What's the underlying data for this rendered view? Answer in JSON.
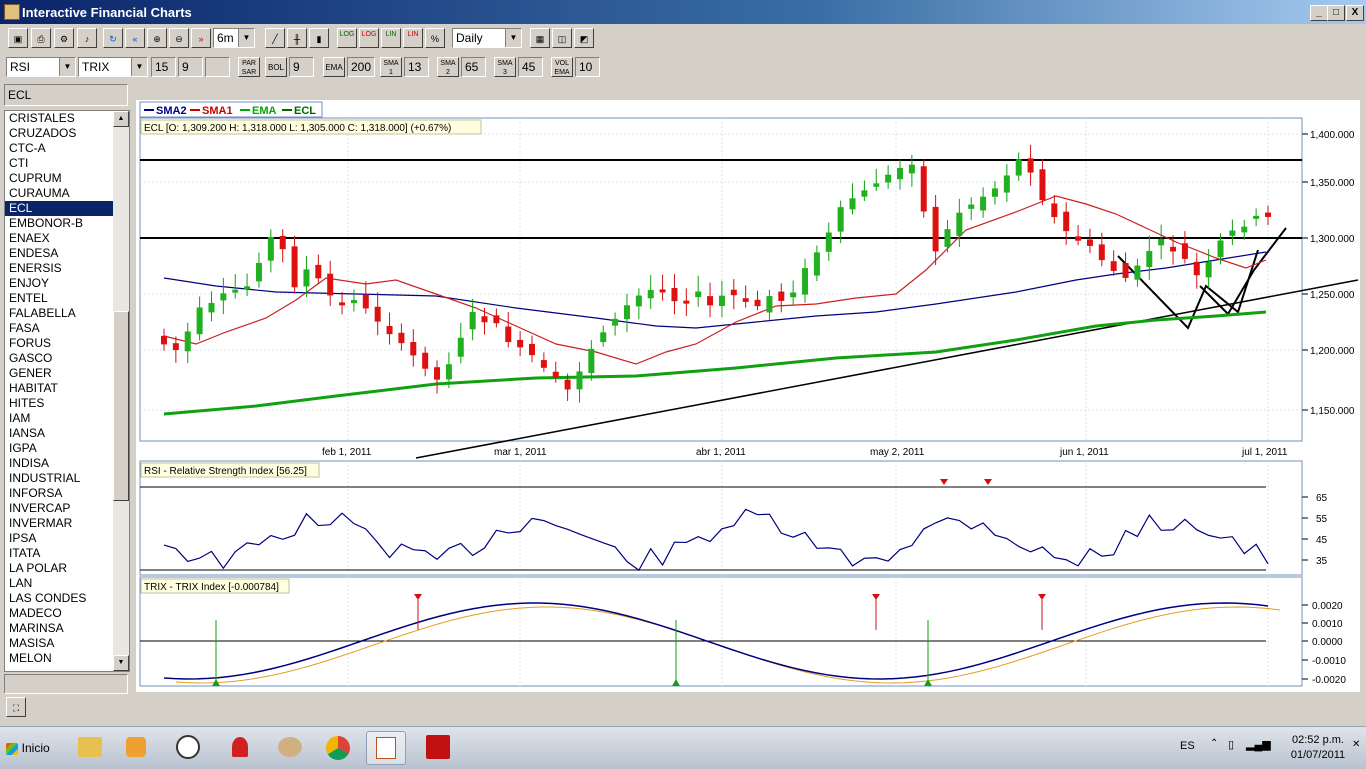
{
  "window": {
    "title": "Interactive Financial Charts",
    "min": "_",
    "max": "□",
    "close": "X"
  },
  "toolbar": {
    "period": "6m",
    "interval": "Daily",
    "log_btn": "LOG",
    "log2_btn": "LOG",
    "lin_btn": "LIN",
    "lin2_btn": "LIN",
    "pct_btn": "%"
  },
  "indicators": {
    "ind1": "RSI",
    "ind2": "TRIX",
    "ind2_p1": "15",
    "ind2_p2": "9",
    "ind2_p3": "",
    "par_sar": "PAR SAR",
    "bol": "BOL",
    "bol_val": "9",
    "ema": "EMA",
    "ema_val": "200",
    "sma1": "SMA 1",
    "sma1_val": "13",
    "sma2": "SMA 2",
    "sma2_val": "65",
    "sma3": "SMA 3",
    "sma3_val": "45",
    "vol_ema": "VOL EMA",
    "vol_ema_val": "10"
  },
  "sidebar": {
    "symbol": "ECL",
    "items": [
      "CRISTALES",
      "CRUZADOS",
      "CTC-A",
      "CTI",
      "CUPRUM",
      "CURAUMA",
      "ECL",
      "EMBONOR-B",
      "ENAEX",
      "ENDESA",
      "ENERSIS",
      "ENJOY",
      "ENTEL",
      "FALABELLA",
      "FASA",
      "FORUS",
      "GASCO",
      "GENER",
      "HABITAT",
      "HITES",
      "IAM",
      "IANSA",
      "IGPA",
      "INDISA",
      "INDUSTRIAL",
      "INFORSA",
      "INVERCAP",
      "INVERMAR",
      "IPSA",
      "ITATA",
      "LA POLAR",
      "LAN",
      "LAS CONDES",
      "MADECO",
      "MARINSA",
      "MASISA",
      "MELON"
    ],
    "selected_index": 6
  },
  "chart": {
    "legend": [
      {
        "name": "SMA2",
        "color": "#000080"
      },
      {
        "name": "SMA1",
        "color": "#cc0000"
      },
      {
        "name": "EMA",
        "color": "#00aa00"
      },
      {
        "name": "ECL",
        "color": "#006600"
      }
    ],
    "ohlc_label": "ECL [O: 1,309.200  H: 1,318.000  L: 1,305.000  C: 1,318.000] (+0.67%)",
    "price_ticks": [
      "1,400.000",
      "1,350.000",
      "1,300.000",
      "1,250.000",
      "1,200.000",
      "1,150.000"
    ],
    "date_ticks": [
      "feb 1, 2011",
      "mar 1, 2011",
      "abr 1, 2011",
      "may 2, 2011",
      "jun 1, 2011",
      "jul 1, 2011"
    ],
    "rsi_label": "RSI - Relative Strength Index [56.25]",
    "rsi_ticks": [
      "65",
      "55",
      "45",
      "35"
    ],
    "trix_label": "TRIX - TRIX Index [-0.000784]",
    "trix_ticks": [
      "0.0020",
      "0.0010",
      "0.0000",
      "-0.0010",
      "-0.0020"
    ]
  },
  "taskbar": {
    "start": "Inicio",
    "lang": "ES",
    "time": "02:52 p.m.",
    "date": "01/07/2011"
  }
}
